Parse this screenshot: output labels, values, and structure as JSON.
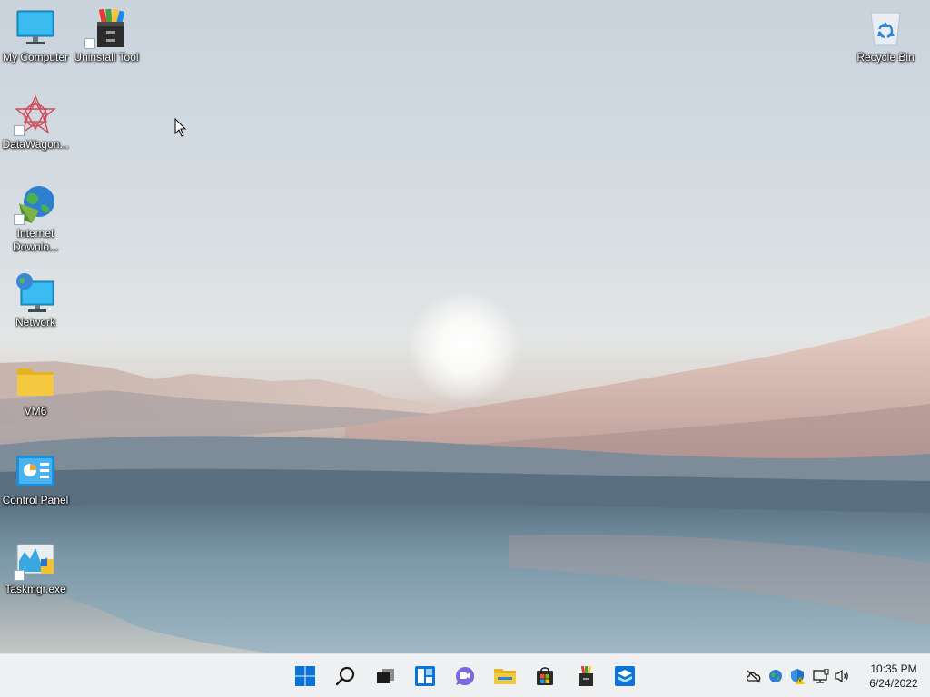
{
  "desktop": {
    "icons": [
      {
        "label": "My Computer",
        "icon": "monitor-icon",
        "shortcut": false
      },
      {
        "label": "Uninstall Tool",
        "icon": "uninstall-tool-icon",
        "shortcut": true
      },
      {
        "label": "DataWagon...",
        "icon": "datawagon-icon",
        "shortcut": true
      },
      {
        "label": "Internet Downlo...",
        "icon": "internet-download-manager-icon",
        "shortcut": true
      },
      {
        "label": "Network",
        "icon": "network-icon",
        "shortcut": false
      },
      {
        "label": "VM6",
        "icon": "folder-icon",
        "shortcut": false
      },
      {
        "label": "Control Panel",
        "icon": "control-panel-icon",
        "shortcut": false
      },
      {
        "label": "Taskmgr.exe",
        "icon": "task-manager-icon",
        "shortcut": true
      },
      {
        "label": "Recycle Bin",
        "icon": "recycle-bin-icon",
        "shortcut": false
      }
    ]
  },
  "taskbar": {
    "apps": [
      {
        "name": "Start",
        "icon": "windows-start-icon"
      },
      {
        "name": "Search",
        "icon": "search-icon"
      },
      {
        "name": "Task View",
        "icon": "task-view-icon"
      },
      {
        "name": "Widgets",
        "icon": "widgets-icon"
      },
      {
        "name": "Chat",
        "icon": "chat-icon"
      },
      {
        "name": "File Explorer",
        "icon": "file-explorer-icon"
      },
      {
        "name": "Microsoft Store",
        "icon": "store-icon"
      },
      {
        "name": "Uninstall Tool",
        "icon": "uninstall-tool-icon"
      },
      {
        "name": "App",
        "icon": "box-app-icon"
      }
    ],
    "tray": [
      {
        "name": "OneDrive",
        "icon": "cloud-offline-icon"
      },
      {
        "name": "Security",
        "icon": "globe-shield-icon"
      },
      {
        "name": "Windows Security",
        "icon": "shield-warning-icon"
      },
      {
        "name": "Network",
        "icon": "network-monitor-icon"
      },
      {
        "name": "Volume",
        "icon": "speaker-icon"
      }
    ],
    "clock": {
      "time": "10:35 PM",
      "date": "6/24/2022"
    }
  },
  "colors": {
    "taskbar_bg": "#eef0f2",
    "accent_blue": "#0a74da",
    "folder_yellow": "#f5c842"
  }
}
